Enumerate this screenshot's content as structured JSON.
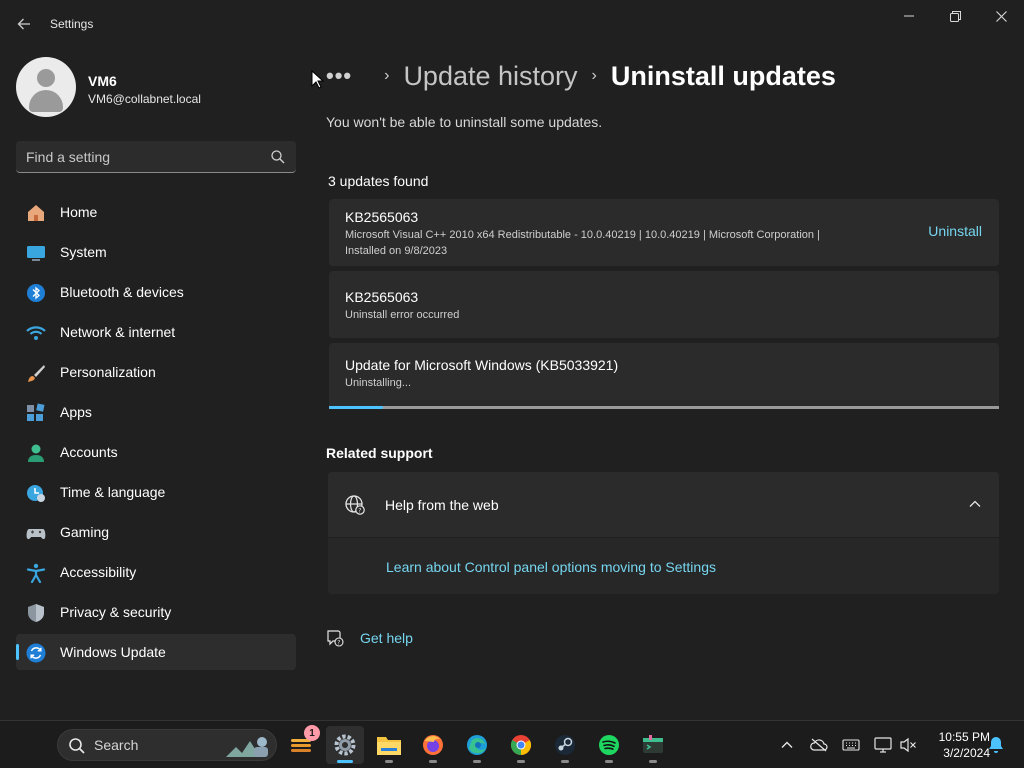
{
  "window": {
    "title": "Settings",
    "back_icon": "back-arrow-icon",
    "controls": [
      "minimize-icon",
      "restore-icon",
      "close-icon"
    ]
  },
  "profile": {
    "name": "VM6",
    "email": "VM6@collabnet.local"
  },
  "search": {
    "placeholder": "Find a setting"
  },
  "sidebar": {
    "items": [
      {
        "label": "Home",
        "icon": "home-icon",
        "active": false
      },
      {
        "label": "System",
        "icon": "system-icon",
        "active": false
      },
      {
        "label": "Bluetooth & devices",
        "icon": "bluetooth-icon",
        "active": false
      },
      {
        "label": "Network & internet",
        "icon": "network-icon",
        "active": false
      },
      {
        "label": "Personalization",
        "icon": "brush-icon",
        "active": false
      },
      {
        "label": "Apps",
        "icon": "apps-icon",
        "active": false
      },
      {
        "label": "Accounts",
        "icon": "accounts-icon",
        "active": false
      },
      {
        "label": "Time & language",
        "icon": "time-language-icon",
        "active": false
      },
      {
        "label": "Gaming",
        "icon": "gamepad-icon",
        "active": false
      },
      {
        "label": "Accessibility",
        "icon": "accessibility-icon",
        "active": false
      },
      {
        "label": "Privacy & security",
        "icon": "shield-icon",
        "active": false
      },
      {
        "label": "Windows Update",
        "icon": "windows-update-icon",
        "active": true
      }
    ]
  },
  "breadcrumb": {
    "dots": "•••",
    "previous": "Update history",
    "current": "Uninstall updates"
  },
  "main": {
    "subtitle": "You won't be able to uninstall some updates.",
    "count_label": "3 updates found",
    "updates": [
      {
        "title": "KB2565063",
        "details": "Microsoft Visual C++ 2010  x64 Redistributable - 10.0.40219  |  10.0.40219  |  Microsoft Corporation  |",
        "installed": "Installed on 9/8/2023",
        "action": "Uninstall"
      },
      {
        "title": "KB2565063",
        "status": "Uninstall error occurred"
      },
      {
        "title": "Update for Microsoft Windows (KB5033921)",
        "status": "Uninstalling...",
        "progress": 0.08
      }
    ]
  },
  "related": {
    "heading": "Related support",
    "help_title": "Help from the web",
    "help_link": "Learn about Control panel options moving to Settings"
  },
  "get_help": "Get help",
  "taskbar": {
    "search_label": "Search",
    "widgets_badge": "1",
    "apps": [
      "widgets-icon",
      "settings-icon",
      "file-explorer-icon",
      "firefox-icon",
      "edge-icon",
      "chrome-icon",
      "steam-icon",
      "spotify-icon",
      "terminal-app-icon"
    ],
    "tray": [
      "chevron-up-icon",
      "cloud-offline-icon",
      "keyboard-icon",
      "network-display-icon",
      "volume-muted-icon"
    ],
    "time": "10:55 PM",
    "date": "3/2/2024"
  },
  "colors": {
    "accent": "#4cc2ff",
    "link": "#76d6f0",
    "background": "#202020",
    "card": "#2b2b2b"
  }
}
